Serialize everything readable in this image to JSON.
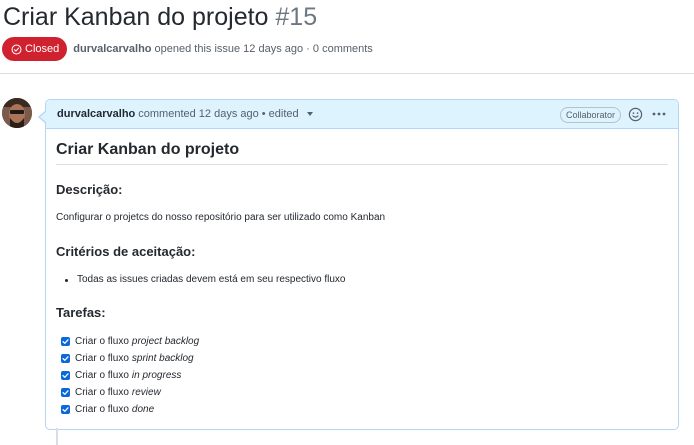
{
  "issue": {
    "title": "Criar Kanban do projeto",
    "number": "#15",
    "state": "Closed",
    "author": "durvalcarvalho",
    "opened_text": "opened this issue 12 days ago · 0 comments"
  },
  "comment": {
    "author": "durvalcarvalho",
    "meta": "commented 12 days ago •",
    "edited": "edited",
    "role_badge": "Collaborator",
    "icons": {
      "reaction": "smiley-icon",
      "menu": "kebab-horizontal-icon",
      "state": "issue-closed-icon"
    },
    "body": {
      "heading": "Criar Kanban do projeto",
      "description_heading": "Descrição:",
      "description_text": "Configurar o projetcs do nosso repositório para ser utilizado como Kanban",
      "criteria_heading": "Critérios de aceitação:",
      "criteria_items": [
        "Todas as issues criadas devem está em seu respectivo fluxo"
      ],
      "tasks_heading": "Tarefas:",
      "tasks": [
        {
          "prefix": "Criar o fluxo",
          "name": "project backlog",
          "checked": true
        },
        {
          "prefix": "Criar o fluxo",
          "name": "sprint backlog",
          "checked": true
        },
        {
          "prefix": "Criar o fluxo",
          "name": "in progress",
          "checked": true
        },
        {
          "prefix": "Criar o fluxo",
          "name": "review",
          "checked": true
        },
        {
          "prefix": "Criar o fluxo",
          "name": "done",
          "checked": true
        }
      ]
    }
  },
  "colors": {
    "closed": "#cf222e",
    "header_bg": "#ddf4ff",
    "border": "#b6d5f5",
    "checkbox": "#0969da"
  }
}
